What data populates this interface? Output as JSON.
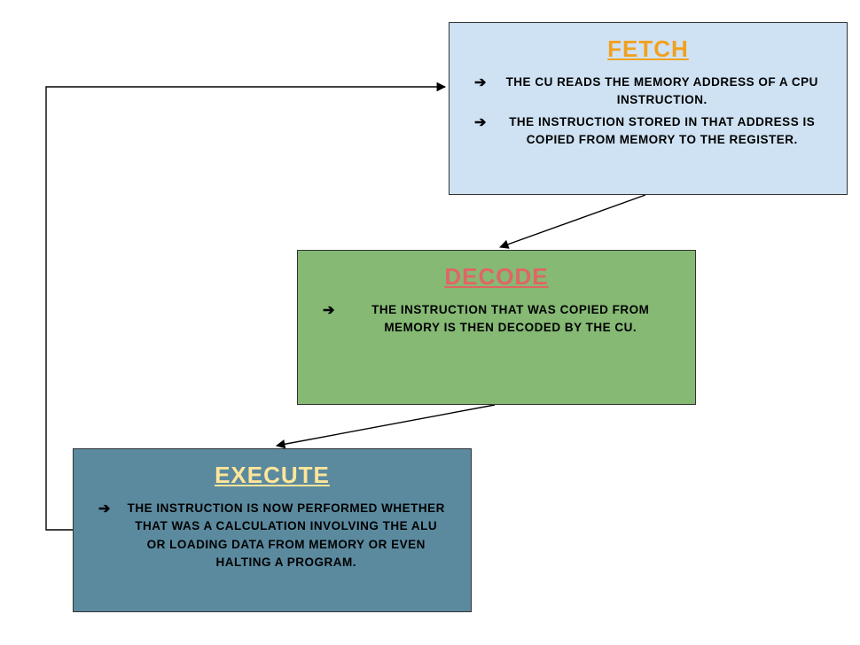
{
  "fetch": {
    "title": "Fetch",
    "bullets": [
      "The CU reads the memory address of a CPU instruction.",
      "The instruction stored in that address is copied from memory to the register."
    ],
    "color": "#cfe2f3",
    "title_color": "#f1a11f"
  },
  "decode": {
    "title": "Decode",
    "bullets": [
      "The instruction that was copied from memory is then decoded by the CU."
    ],
    "color": "#85b974",
    "title_color": "#e06666"
  },
  "execute": {
    "title": "Execute",
    "bullets": [
      "The instruction is now performed whether that was a calculation involving the ALU or loading data from memory or even halting a program."
    ],
    "color": "#5b8a9f",
    "title_color": "#ffe599"
  },
  "arrow_glyph": "➔"
}
